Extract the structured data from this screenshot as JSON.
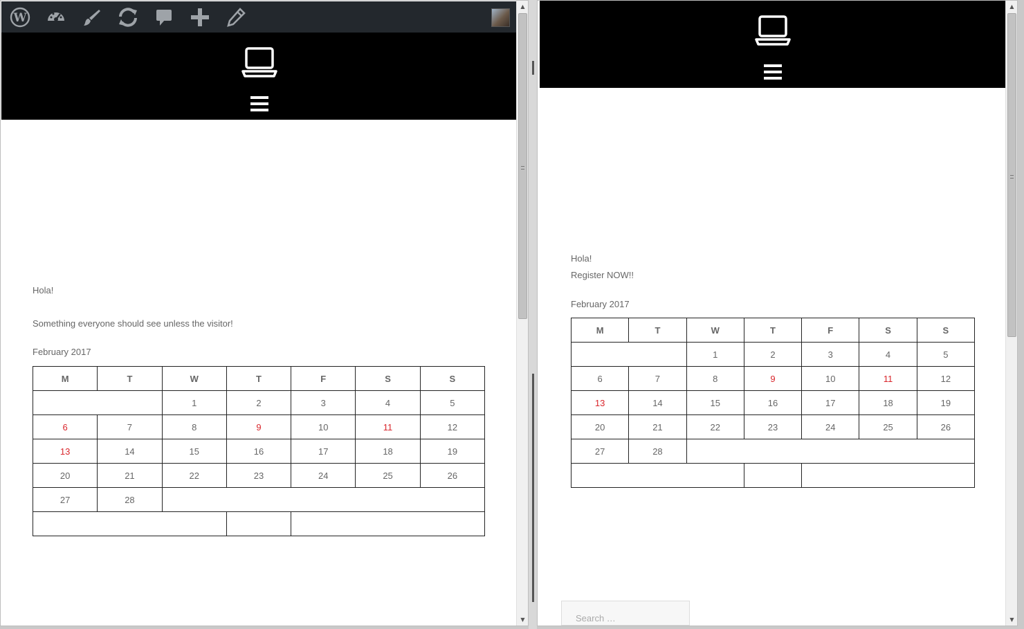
{
  "left_window": {
    "adminbar": {
      "icons": [
        "wordpress-logo-icon",
        "dashboard-icon",
        "customize-brush-icon",
        "updates-refresh-icon",
        "comments-icon",
        "new-content-plus-icon",
        "edit-pencil-icon"
      ]
    },
    "content": {
      "greeting": "Hola!",
      "message": "Something everyone should see unless the visitor!",
      "calendar": {
        "caption": "February 2017",
        "weekdays": [
          "M",
          "T",
          "W",
          "T",
          "F",
          "S",
          "S"
        ],
        "week1": [
          "1",
          "2",
          "3",
          "4",
          "5"
        ],
        "week2": [
          "6",
          "7",
          "8",
          "9",
          "10",
          "11",
          "12"
        ],
        "week3": [
          "13",
          "14",
          "15",
          "16",
          "17",
          "18",
          "19"
        ],
        "week4": [
          "20",
          "21",
          "22",
          "23",
          "24",
          "25",
          "26"
        ],
        "week5": [
          "27",
          "28"
        ],
        "highlight_color": "#d9262c"
      }
    }
  },
  "right_window": {
    "content": {
      "greeting": "Hola!",
      "cta": "Register NOW!!",
      "calendar": {
        "caption": "February 2017",
        "weekdays": [
          "M",
          "T",
          "W",
          "T",
          "F",
          "S",
          "S"
        ],
        "week1": [
          "1",
          "2",
          "3",
          "4",
          "5"
        ],
        "week2": [
          "6",
          "7",
          "8",
          "9",
          "10",
          "11",
          "12"
        ],
        "week3": [
          "13",
          "14",
          "15",
          "16",
          "17",
          "18",
          "19"
        ],
        "week4": [
          "20",
          "21",
          "22",
          "23",
          "24",
          "25",
          "26"
        ],
        "week5": [
          "27",
          "28"
        ]
      },
      "search": {
        "placeholder": "Search …"
      }
    }
  },
  "colors": {
    "header_bg": "#000000",
    "adminbar_bg": "#23282d",
    "text": "#666666",
    "accent_red": "#d9262c"
  }
}
